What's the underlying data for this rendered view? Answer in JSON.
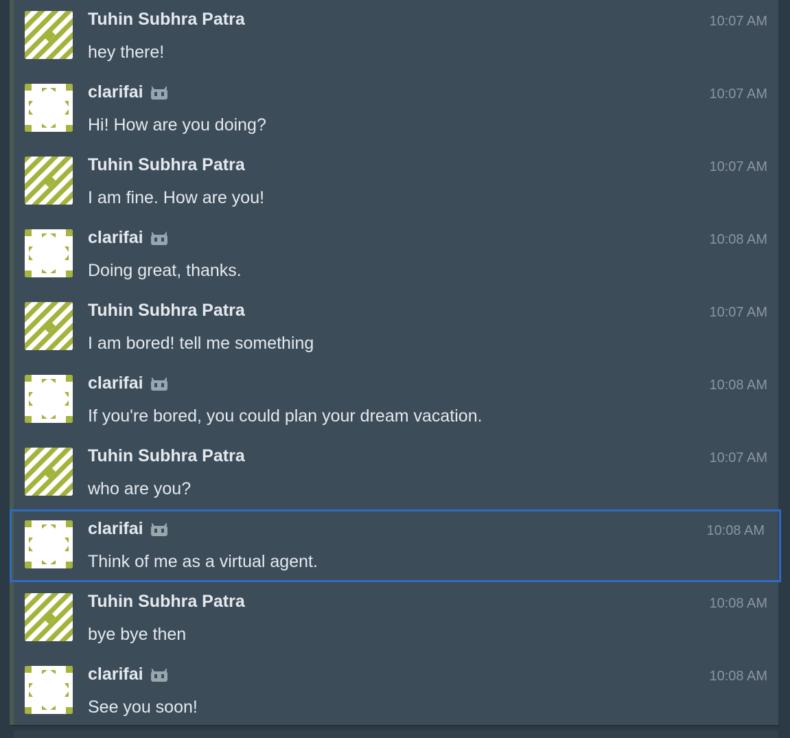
{
  "messages": [
    {
      "sender": "Tuhin Subhra Patra",
      "bot": false,
      "time": "10:07 AM",
      "text": "hey there!",
      "selected": false
    },
    {
      "sender": "clarifai",
      "bot": true,
      "time": "10:07 AM",
      "text": "Hi! How are you doing?",
      "selected": false
    },
    {
      "sender": "Tuhin Subhra Patra",
      "bot": false,
      "time": "10:07 AM",
      "text": "I am fine. How are you!",
      "selected": false
    },
    {
      "sender": "clarifai",
      "bot": true,
      "time": "10:08 AM",
      "text": "Doing great, thanks.",
      "selected": false
    },
    {
      "sender": "Tuhin Subhra Patra",
      "bot": false,
      "time": "10:07 AM",
      "text": "I am bored! tell me something",
      "selected": false
    },
    {
      "sender": "clarifai",
      "bot": true,
      "time": "10:08 AM",
      "text": "If you're bored, you could plan your dream vacation.",
      "selected": false
    },
    {
      "sender": "Tuhin Subhra Patra",
      "bot": false,
      "time": "10:07 AM",
      "text": "who are you?",
      "selected": false
    },
    {
      "sender": "clarifai",
      "bot": true,
      "time": "10:08 AM",
      "text": "Think of me as a virtual agent.",
      "selected": true
    },
    {
      "sender": "Tuhin Subhra Patra",
      "bot": false,
      "time": "10:08 AM",
      "text": "bye bye then",
      "selected": false
    },
    {
      "sender": "clarifai",
      "bot": true,
      "time": "10:08 AM",
      "text": "See you soon!",
      "selected": false
    }
  ],
  "colors": {
    "background": "#3d4c59",
    "avatar_pattern": "#a3b33c",
    "selection_outline": "#2f6bc2",
    "name_text": "#e4e9ee",
    "timestamp_text": "#8b97a1"
  },
  "icons": {
    "bot_badge": "bot-icon",
    "user_avatar": "identicon-user",
    "bot_avatar": "identicon-bot"
  }
}
